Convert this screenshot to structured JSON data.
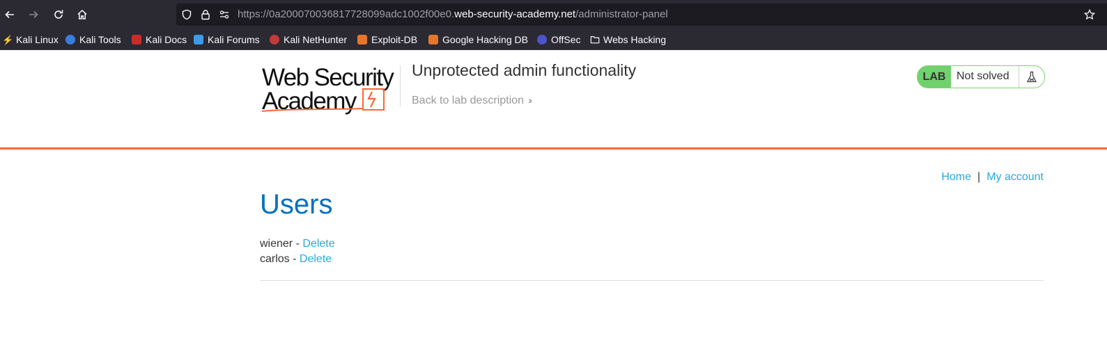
{
  "browser": {
    "url_prefix": "https://0a200070036817728099adc1002f00e0.",
    "url_host": "web-security-academy.net",
    "url_path": "/administrator-panel",
    "bookmarks": [
      {
        "label": "Kali Linux",
        "icon": "kali-dragon-icon"
      },
      {
        "label": "Kali Tools",
        "icon": "kali-tools-icon"
      },
      {
        "label": "Kali Docs",
        "icon": "kali-docs-icon"
      },
      {
        "label": "Kali Forums",
        "icon": "kali-forums-icon"
      },
      {
        "label": "Kali NetHunter",
        "icon": "kali-nethunter-icon"
      },
      {
        "label": "Exploit-DB",
        "icon": "exploit-db-icon"
      },
      {
        "label": "Google Hacking DB",
        "icon": "ghdb-icon"
      },
      {
        "label": "OffSec",
        "icon": "offsec-icon"
      },
      {
        "label": "Webs Hacking",
        "icon": "folder-icon"
      }
    ]
  },
  "header": {
    "logo_line1": "Web Security",
    "logo_line2": "Academy",
    "lab_title": "Unprotected admin functionality",
    "back_link": "Back to lab description",
    "status_tag": "LAB",
    "status_text": "Not solved",
    "brand_color": "#ff6633",
    "status_color": "#70d16d"
  },
  "nav": {
    "home": "Home",
    "separator": "|",
    "my_account": "My account"
  },
  "main": {
    "title": "Users",
    "users": [
      {
        "name": "wiener",
        "dash": "-",
        "action": "Delete"
      },
      {
        "name": "carlos",
        "dash": "-",
        "action": "Delete"
      }
    ]
  }
}
